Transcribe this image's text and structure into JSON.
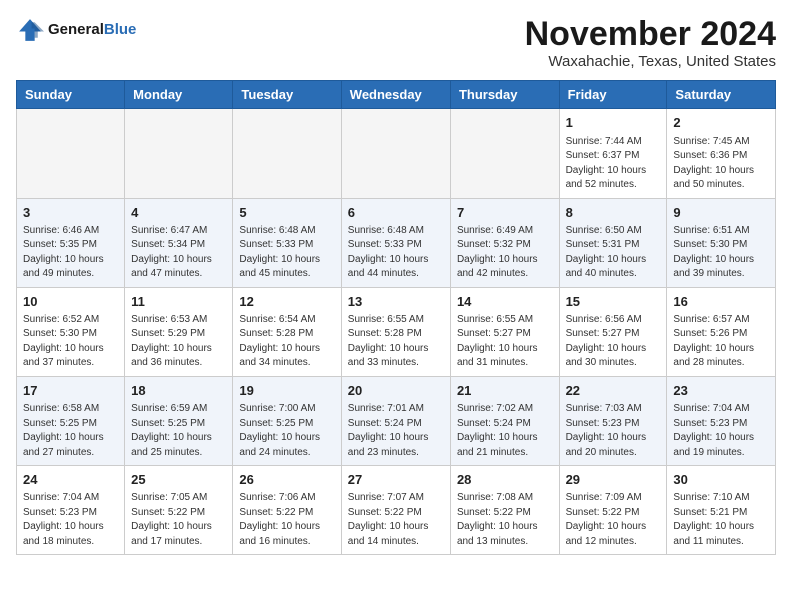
{
  "header": {
    "logo_line1": "General",
    "logo_line2": "Blue",
    "month": "November 2024",
    "location": "Waxahachie, Texas, United States"
  },
  "days_of_week": [
    "Sunday",
    "Monday",
    "Tuesday",
    "Wednesday",
    "Thursday",
    "Friday",
    "Saturday"
  ],
  "weeks": [
    {
      "days": [
        {
          "num": "",
          "info": ""
        },
        {
          "num": "",
          "info": ""
        },
        {
          "num": "",
          "info": ""
        },
        {
          "num": "",
          "info": ""
        },
        {
          "num": "",
          "info": ""
        },
        {
          "num": "1",
          "info": "Sunrise: 7:44 AM\nSunset: 6:37 PM\nDaylight: 10 hours and 52 minutes."
        },
        {
          "num": "2",
          "info": "Sunrise: 7:45 AM\nSunset: 6:36 PM\nDaylight: 10 hours and 50 minutes."
        }
      ]
    },
    {
      "days": [
        {
          "num": "3",
          "info": "Sunrise: 6:46 AM\nSunset: 5:35 PM\nDaylight: 10 hours and 49 minutes."
        },
        {
          "num": "4",
          "info": "Sunrise: 6:47 AM\nSunset: 5:34 PM\nDaylight: 10 hours and 47 minutes."
        },
        {
          "num": "5",
          "info": "Sunrise: 6:48 AM\nSunset: 5:33 PM\nDaylight: 10 hours and 45 minutes."
        },
        {
          "num": "6",
          "info": "Sunrise: 6:48 AM\nSunset: 5:33 PM\nDaylight: 10 hours and 44 minutes."
        },
        {
          "num": "7",
          "info": "Sunrise: 6:49 AM\nSunset: 5:32 PM\nDaylight: 10 hours and 42 minutes."
        },
        {
          "num": "8",
          "info": "Sunrise: 6:50 AM\nSunset: 5:31 PM\nDaylight: 10 hours and 40 minutes."
        },
        {
          "num": "9",
          "info": "Sunrise: 6:51 AM\nSunset: 5:30 PM\nDaylight: 10 hours and 39 minutes."
        }
      ]
    },
    {
      "days": [
        {
          "num": "10",
          "info": "Sunrise: 6:52 AM\nSunset: 5:30 PM\nDaylight: 10 hours and 37 minutes."
        },
        {
          "num": "11",
          "info": "Sunrise: 6:53 AM\nSunset: 5:29 PM\nDaylight: 10 hours and 36 minutes."
        },
        {
          "num": "12",
          "info": "Sunrise: 6:54 AM\nSunset: 5:28 PM\nDaylight: 10 hours and 34 minutes."
        },
        {
          "num": "13",
          "info": "Sunrise: 6:55 AM\nSunset: 5:28 PM\nDaylight: 10 hours and 33 minutes."
        },
        {
          "num": "14",
          "info": "Sunrise: 6:55 AM\nSunset: 5:27 PM\nDaylight: 10 hours and 31 minutes."
        },
        {
          "num": "15",
          "info": "Sunrise: 6:56 AM\nSunset: 5:27 PM\nDaylight: 10 hours and 30 minutes."
        },
        {
          "num": "16",
          "info": "Sunrise: 6:57 AM\nSunset: 5:26 PM\nDaylight: 10 hours and 28 minutes."
        }
      ]
    },
    {
      "days": [
        {
          "num": "17",
          "info": "Sunrise: 6:58 AM\nSunset: 5:25 PM\nDaylight: 10 hours and 27 minutes."
        },
        {
          "num": "18",
          "info": "Sunrise: 6:59 AM\nSunset: 5:25 PM\nDaylight: 10 hours and 25 minutes."
        },
        {
          "num": "19",
          "info": "Sunrise: 7:00 AM\nSunset: 5:25 PM\nDaylight: 10 hours and 24 minutes."
        },
        {
          "num": "20",
          "info": "Sunrise: 7:01 AM\nSunset: 5:24 PM\nDaylight: 10 hours and 23 minutes."
        },
        {
          "num": "21",
          "info": "Sunrise: 7:02 AM\nSunset: 5:24 PM\nDaylight: 10 hours and 21 minutes."
        },
        {
          "num": "22",
          "info": "Sunrise: 7:03 AM\nSunset: 5:23 PM\nDaylight: 10 hours and 20 minutes."
        },
        {
          "num": "23",
          "info": "Sunrise: 7:04 AM\nSunset: 5:23 PM\nDaylight: 10 hours and 19 minutes."
        }
      ]
    },
    {
      "days": [
        {
          "num": "24",
          "info": "Sunrise: 7:04 AM\nSunset: 5:23 PM\nDaylight: 10 hours and 18 minutes."
        },
        {
          "num": "25",
          "info": "Sunrise: 7:05 AM\nSunset: 5:22 PM\nDaylight: 10 hours and 17 minutes."
        },
        {
          "num": "26",
          "info": "Sunrise: 7:06 AM\nSunset: 5:22 PM\nDaylight: 10 hours and 16 minutes."
        },
        {
          "num": "27",
          "info": "Sunrise: 7:07 AM\nSunset: 5:22 PM\nDaylight: 10 hours and 14 minutes."
        },
        {
          "num": "28",
          "info": "Sunrise: 7:08 AM\nSunset: 5:22 PM\nDaylight: 10 hours and 13 minutes."
        },
        {
          "num": "29",
          "info": "Sunrise: 7:09 AM\nSunset: 5:22 PM\nDaylight: 10 hours and 12 minutes."
        },
        {
          "num": "30",
          "info": "Sunrise: 7:10 AM\nSunset: 5:21 PM\nDaylight: 10 hours and 11 minutes."
        }
      ]
    }
  ]
}
